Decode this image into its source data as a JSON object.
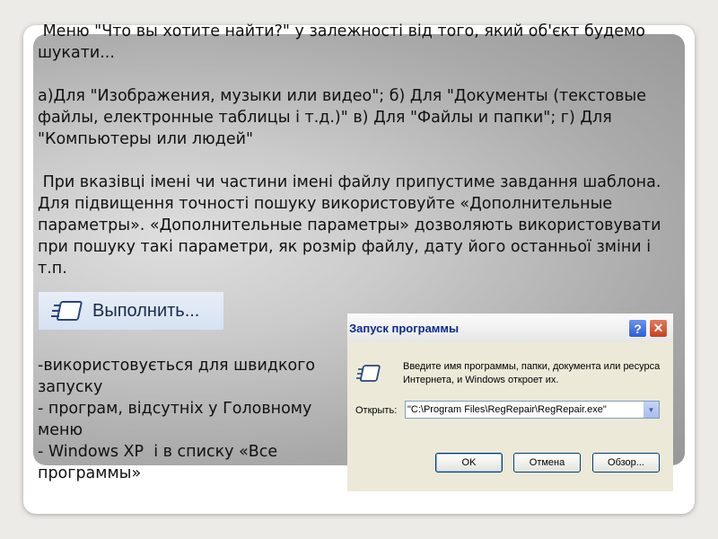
{
  "slide": {
    "intro": " Меню \"Что вы хотите найти?\" у залежності від того, який об'єкт будемо шукати...",
    "options": "а)Для \"Изображения, музыки или видео\"; б) Для \"Документы (текстовые файлы, електронные таблицы і т.д.)\" в) Для \"Файлы и папки\"; г) Для \"Компьютеры или людей\"",
    "hint": " При вказівці імені чи частини імені файлу припустиме завдання шаблона. Для підвищення точності пошуку використовуйте «Дополнительные параметры». «Дополнительные параметры» дозволяють використовувати при пошуку такі параметри, як розмір файлу, дату його останньої зміни і т.п.",
    "run_description": "-використовується для швидкого запуску\n- програм, відсутніх у Головному меню\n- Windows XP  і в списку «Все программы»"
  },
  "run_menu_item": {
    "label": "Выполнить...",
    "icon": "run-icon"
  },
  "dialog": {
    "title": "Запуск программы",
    "help_button": "?",
    "close_button": "✕",
    "description": "Введите имя программы, папки, документа или ресурса Интернета, и Windows откроет их.",
    "open_label": "Открыть:",
    "open_value": "\"C:\\Program Files\\RegRepair\\RegRepair.exe\"",
    "ok": "OK",
    "cancel": "Отмена",
    "browse": "Обзор..."
  },
  "colors": {
    "frame_background": "#ecebe7",
    "panel_gray": "#aaaaaa",
    "dialog_face": "#ece9d8",
    "title_text": "#0b2c8c"
  }
}
